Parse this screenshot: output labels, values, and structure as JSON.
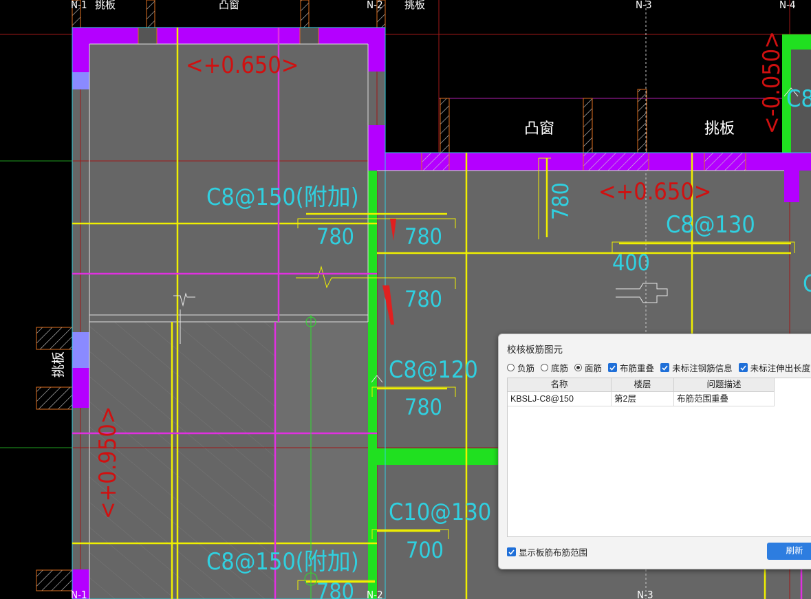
{
  "drawing": {
    "grid_labels": {
      "n1": "N-1",
      "n2": "N-2",
      "n3": "N-3",
      "n4": "N-4"
    },
    "labels": {
      "tiaoban": "挑板",
      "tuchuang": "凸窗",
      "elev_top_left": "<+0.650>",
      "elev_top_right": "<+0.650>",
      "elev_left": "<+0.950>",
      "elev_right": "<-0.050>",
      "c8_150_fujia": "C8@150(附加)",
      "c8_130": "C8@130",
      "c8_120": "C8@120",
      "c10_130": "C10@130",
      "c8_partial": "C8",
      "c_partial": "C",
      "dim_780": "780",
      "dim_700": "700",
      "dim_400": "400"
    },
    "colors": {
      "slab": "#666666",
      "magenta": "#b400ff",
      "green": "#20e020",
      "yellow": "#f0f000",
      "cyan": "#30d0e0",
      "red_text": "#d01010",
      "pink": "#e030e0"
    }
  },
  "dialog": {
    "title": "校核板筋图元",
    "radios": [
      {
        "label": "负筋",
        "selected": false
      },
      {
        "label": "底筋",
        "selected": false
      },
      {
        "label": "面筋",
        "selected": true
      }
    ],
    "checks": [
      {
        "label": "布筋重叠",
        "checked": true
      },
      {
        "label": "未标注钢筋信息",
        "checked": true
      },
      {
        "label": "未标注伸出长度",
        "checked": true
      }
    ],
    "table": {
      "columns": [
        "名称",
        "楼层",
        "问题描述"
      ],
      "rows": [
        {
          "name": "KBSLJ-C8@150",
          "floor": "第2层",
          "desc": "布筋范围重叠"
        }
      ]
    },
    "show_range_label": "显示板筋布筋范围",
    "show_range_checked": true,
    "refresh_label": "刷新"
  }
}
